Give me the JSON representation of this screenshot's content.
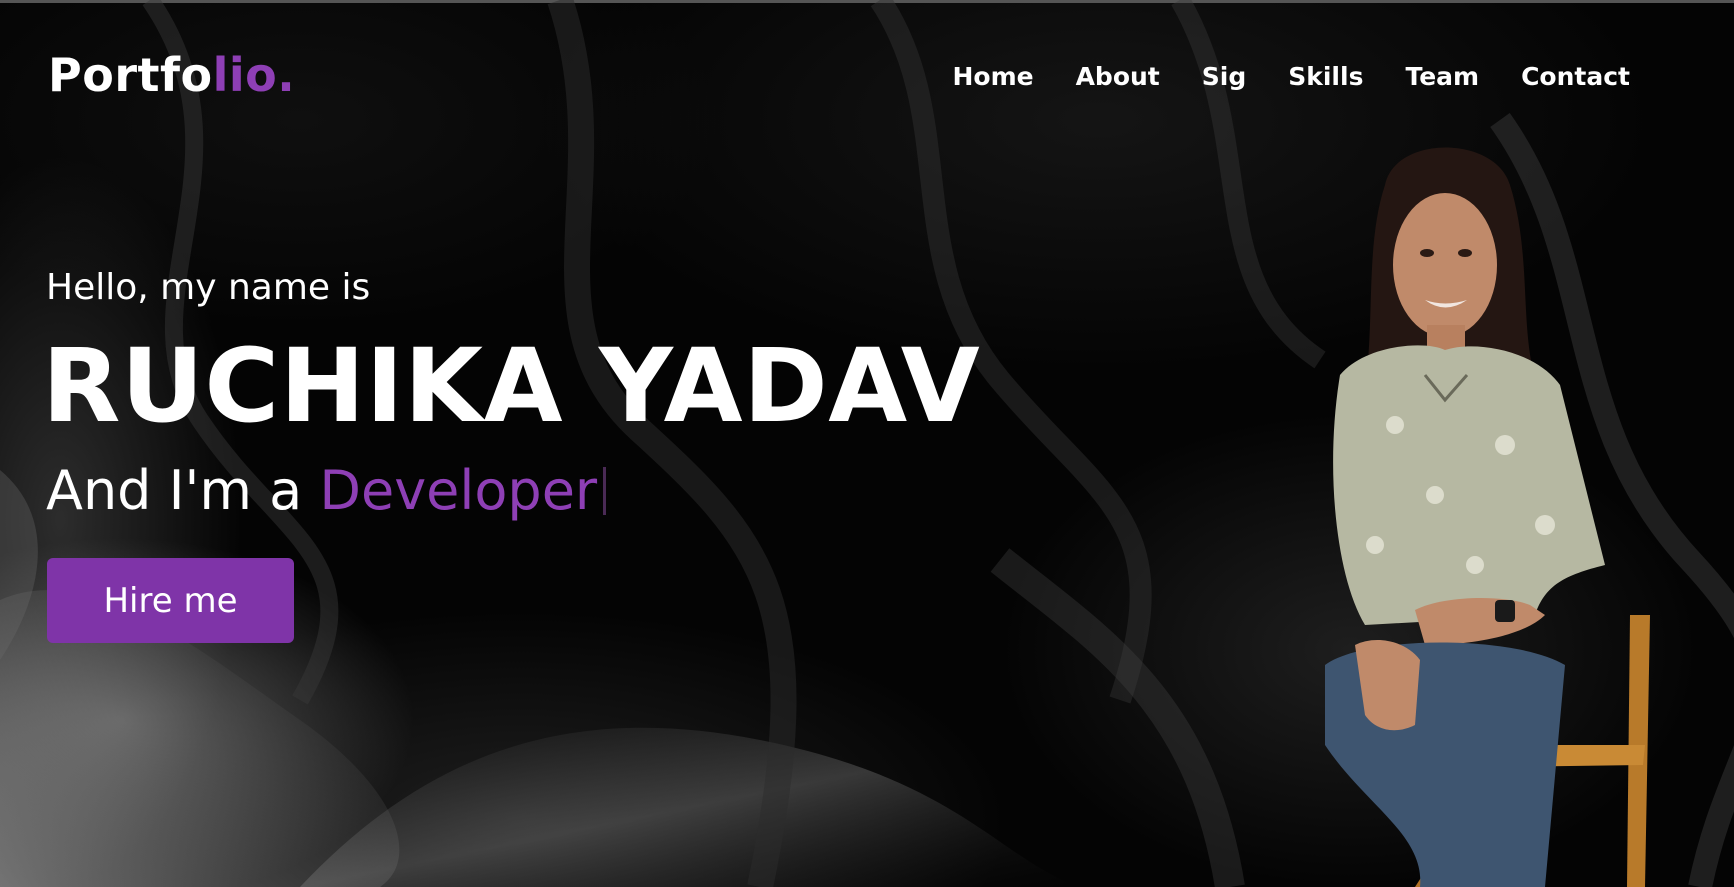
{
  "header": {
    "logo_main": "Portfo",
    "logo_accent": "lio.",
    "nav": [
      "Home",
      "About",
      "Sig",
      "Skills",
      "Team",
      "Contact"
    ]
  },
  "hero": {
    "greeting": "Hello, my name is",
    "name": "RUCHIKA YADAV",
    "role_prefix": "And I'm a ",
    "role_word": "Developer",
    "cta_label": "Hire me"
  },
  "colors": {
    "accent": "#8e3fb5",
    "button": "#7f34a8",
    "background": "#040404",
    "text": "#ffffff"
  }
}
